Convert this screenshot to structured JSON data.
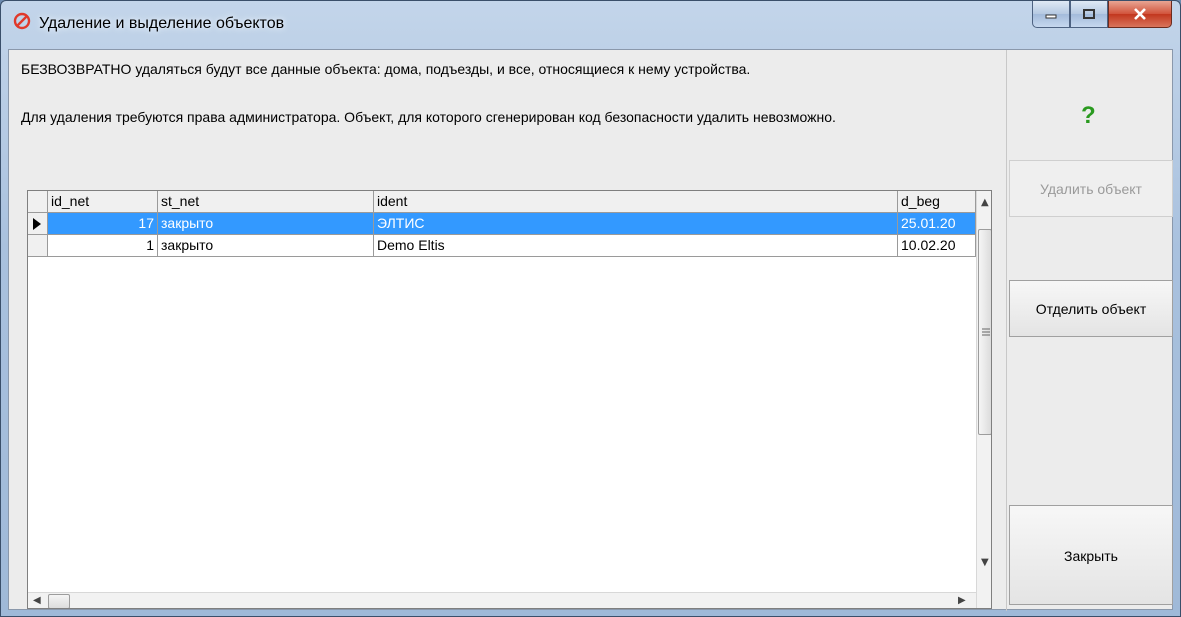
{
  "window": {
    "title": "Удаление и выделение объектов",
    "icon": "no-entry-icon"
  },
  "message": {
    "line1": "БЕЗВОЗВРАТНО удаляться будут все данные объекта: дома, подъезды, и все, относящиеся к нему устройства.",
    "line2": "Для удаления требуются права администратора. Объект, для которого сгенерирован код безопасности удалить невозможно."
  },
  "grid": {
    "columns": [
      "id_net",
      "st_net",
      "ident",
      "d_beg"
    ],
    "rows": [
      {
        "id_net": "17",
        "st_net": "закрыто",
        "ident": "ЭЛТИС",
        "d_beg": "25.01.20",
        "selected": true
      },
      {
        "id_net": "1",
        "st_net": "закрыто",
        "ident": "Demo Eltis",
        "d_beg": "10.02.20",
        "selected": false
      }
    ]
  },
  "side": {
    "help_label": "?",
    "delete_label": "Удалить объект",
    "separate_label": "Отделить объект",
    "close_label": "Закрыть"
  },
  "colors": {
    "selection": "#3399ff",
    "help": "#2a9a1f",
    "close_button": "#c2371e"
  }
}
